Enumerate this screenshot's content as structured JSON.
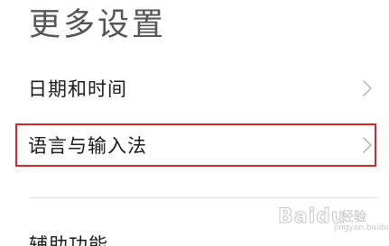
{
  "page": {
    "title": "更多设置"
  },
  "settings_rows": [
    {
      "label": "日期和时间",
      "chevron_icon": "chevron-right-icon"
    },
    {
      "label": "语言与输入法",
      "chevron_icon": "chevron-right-icon",
      "highlighted": true,
      "highlight_color": "#d9252b"
    }
  ],
  "partial_row": {
    "label": "辅助功能"
  },
  "watermark": {
    "brand": "Baidu",
    "sub": "经验",
    "url": "jingyan.baidu.com"
  }
}
